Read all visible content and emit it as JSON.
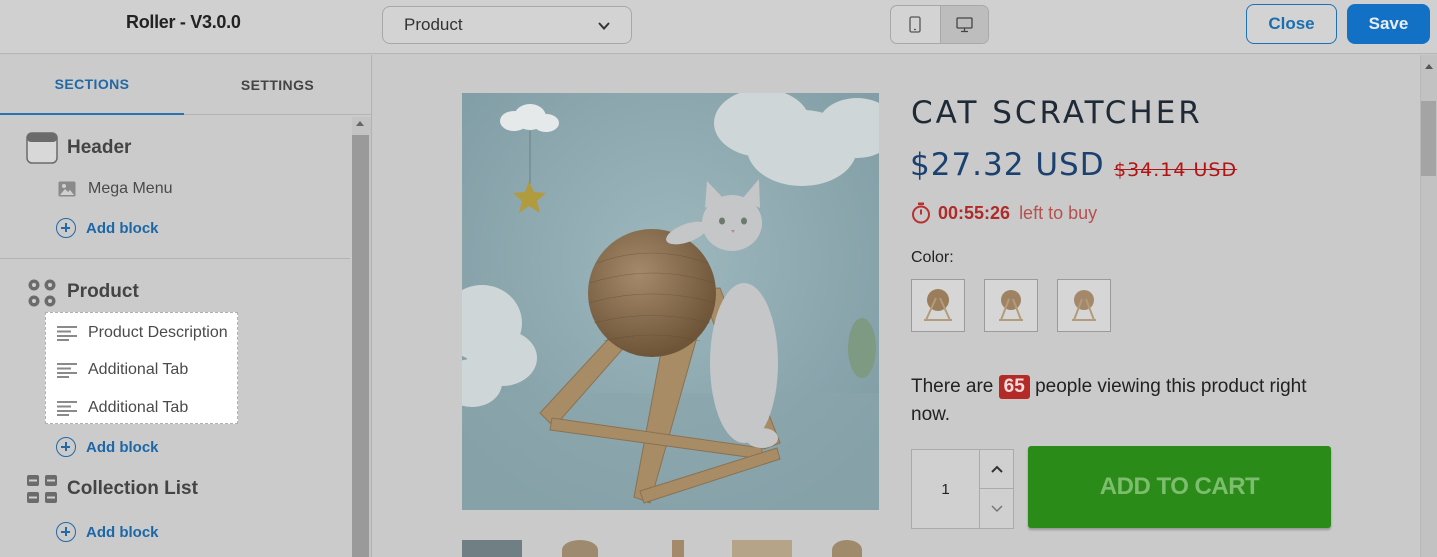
{
  "app": {
    "title": "Roller - V3.0.0"
  },
  "header": {
    "page_select": {
      "value": "Product"
    },
    "devices": [
      {
        "icon": "mobile-icon"
      },
      {
        "icon": "desktop-icon",
        "active": true
      }
    ],
    "close_label": "Close",
    "save_label": "Save"
  },
  "sidebar": {
    "tabs": [
      {
        "label": "SECTIONS",
        "active": true
      },
      {
        "label": "SETTINGS"
      }
    ],
    "sections": [
      {
        "title": "Header",
        "icon": "header-section-icon",
        "blocks": [
          {
            "label": "Mega Menu",
            "icon": "image-icon"
          }
        ],
        "add_block_label": "Add block"
      },
      {
        "title": "Product",
        "icon": "product-grid-icon",
        "blocks": [
          {
            "label": "Product Description",
            "icon": "text-lines-icon"
          },
          {
            "label": "Additional Tab",
            "icon": "text-lines-icon"
          },
          {
            "label": "Additional Tab",
            "icon": "text-lines-icon"
          }
        ],
        "add_block_label": "Add block"
      },
      {
        "title": "Collection List",
        "icon": "collection-list-icon",
        "blocks": [],
        "add_block_label": "Add block"
      }
    ]
  },
  "preview": {
    "product": {
      "title": "CAT SCRATCHER",
      "price": "$27.32 USD",
      "compare_price": "$34.14 USD",
      "timer": {
        "time": "00:55:26",
        "suffix": "left to buy",
        "icon": "stopwatch-icon"
      },
      "color_label": "Color:",
      "viewers": {
        "prefix": "There are",
        "count": "65",
        "suffix": "people viewing this product right now."
      },
      "quantity": "1",
      "add_to_cart_label": "ADD TO CART"
    }
  },
  "colors": {
    "accent": "#1271c4",
    "add_to_cart": "#2b8b18",
    "sale": "#b21313"
  }
}
